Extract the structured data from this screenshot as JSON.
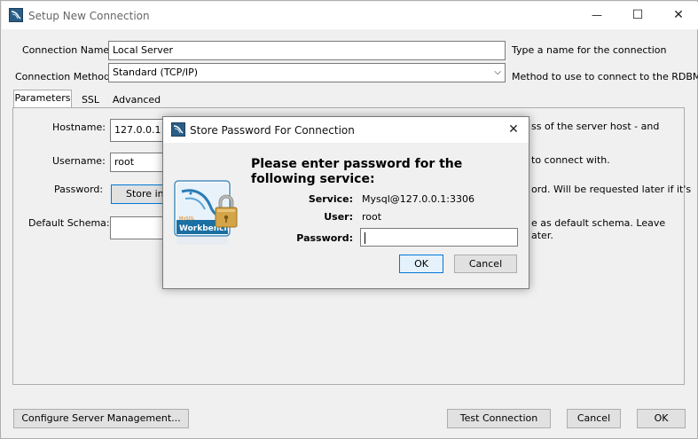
{
  "window": {
    "title": "Setup New Connection",
    "minimize": "—",
    "maximize": "☐",
    "close": "✕"
  },
  "form": {
    "connection_name_label": "Connection Name:",
    "connection_name_value": "Local Server",
    "connection_name_hint": "Type a name for the connection",
    "method_label": "Connection Method:",
    "method_value": "Standard (TCP/IP)",
    "method_hint": "Method to use to connect to the RDBMS"
  },
  "tabs": [
    {
      "label": "Parameters",
      "active": true
    },
    {
      "label": "SSL",
      "active": false
    },
    {
      "label": "Advanced",
      "active": false
    }
  ],
  "params": {
    "hostname_label": "Hostname:",
    "hostname_value": "127.0.0.1",
    "hostname_hint": "ss of the server host - and",
    "username_label": "Username:",
    "username_value": "root",
    "username_hint": "to connect with.",
    "password_label": "Password:",
    "store_button": "Store in V",
    "password_hint": "ord. Will be requested later if it's",
    "schema_label": "Default Schema:",
    "schema_value": "",
    "schema_hint_1": "e as default schema. Leave",
    "schema_hint_2": "ater."
  },
  "footer": {
    "configure_button": "Configure Server Management...",
    "test_button": "Test Connection",
    "cancel_button": "Cancel",
    "ok_button": "OK"
  },
  "dialog": {
    "title": "Store Password For Connection",
    "close": "✕",
    "heading": "Please enter password for the following service:",
    "service_label": "Service:",
    "service_value": "Mysql@127.0.0.1:3306",
    "user_label": "User:",
    "user_value": "root",
    "password_label": "Password:",
    "password_value": "",
    "ok_button": "OK",
    "cancel_button": "Cancel",
    "logo_text_small": "MySQL",
    "logo_text": "Workbench"
  },
  "colors": {
    "accent": "#0078d7",
    "logo_blue": "#1a6fa3",
    "lock_gold": "#d3a548"
  }
}
